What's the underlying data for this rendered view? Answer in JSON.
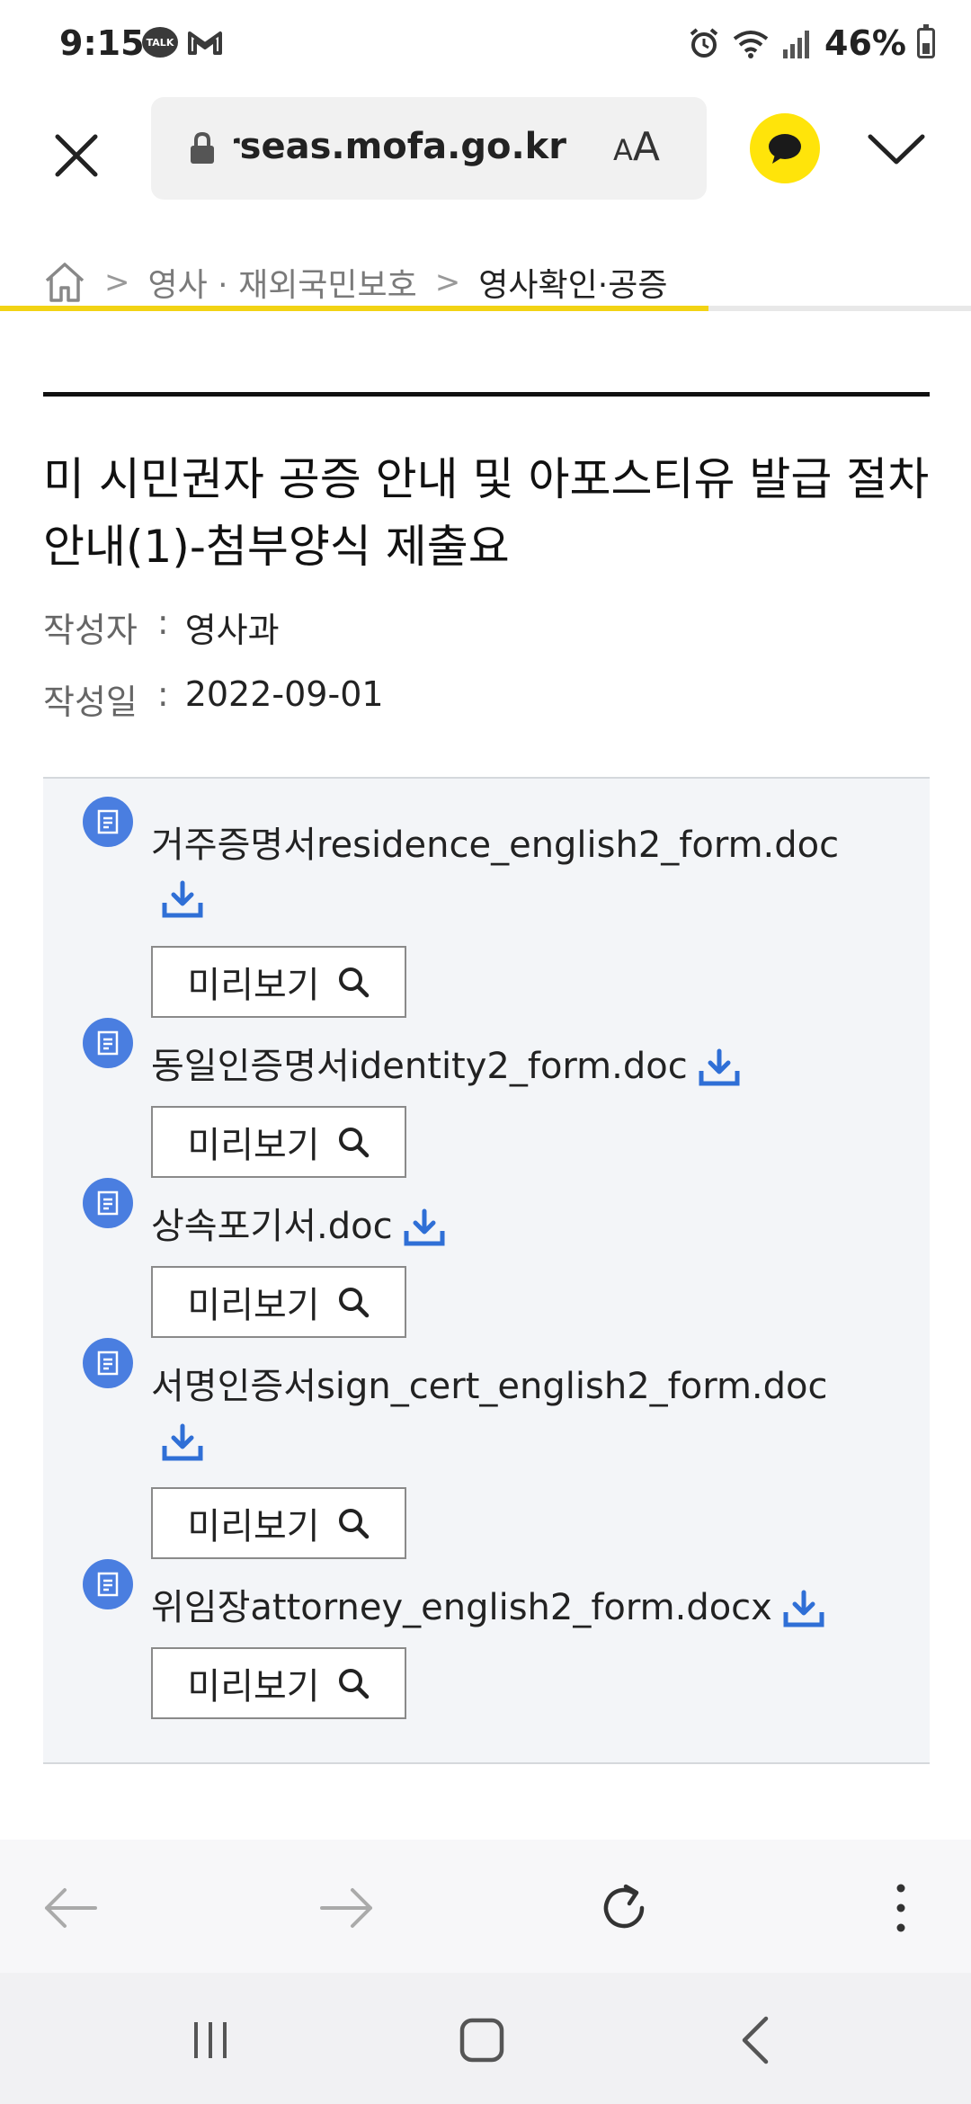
{
  "status_bar": {
    "time": "9:15",
    "battery": "46%",
    "icons": [
      "kakaotalk-icon",
      "gmail-icon",
      "alarm-icon",
      "wifi-icon",
      "signal-icon",
      "battery-icon"
    ],
    "talk_badge": "TALK"
  },
  "browser": {
    "url": "overseas.mofa.go.kr",
    "text_size_label": "AA",
    "accent_color": "#f2d314",
    "kakao_color": "#ffe40a",
    "load_progress": 0.73
  },
  "breadcrumb": {
    "items": [
      "영사 · 재외국민보호",
      "영사확인·공증"
    ],
    "separator": ">"
  },
  "post": {
    "title": "미 시민권자 공증 안내 및 아포스티유 발급 절차 안내(1)-첨부양식 제출요",
    "author_label": "작성자",
    "author": "영사과",
    "date_label": "작성일",
    "date": "2022-09-01",
    "colon": ":"
  },
  "attachments": [
    {
      "name": "거주증명서residence_english2_form.doc",
      "preview_label": "미리보기"
    },
    {
      "name": "동일인증명서identity2_form.doc",
      "preview_label": "미리보기"
    },
    {
      "name": "상속포기서.doc",
      "preview_label": "미리보기"
    },
    {
      "name": "서명인증서sign_cert_english2_form.doc",
      "preview_label": "미리보기"
    },
    {
      "name": "위임장attorney_english2_form.docx",
      "preview_label": "미리보기"
    }
  ],
  "colors": {
    "file_icon": "#4a7ee0",
    "download_icon": "#2f6fd6",
    "panel_bg": "#f3f5f8"
  }
}
